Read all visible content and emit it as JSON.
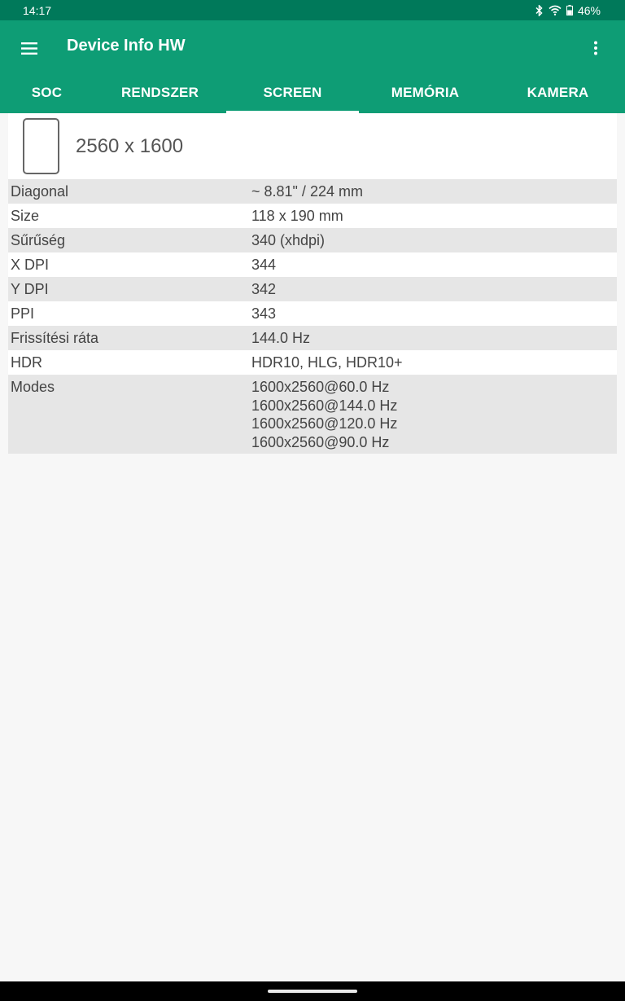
{
  "status_bar": {
    "time": "14:17",
    "battery": "46%",
    "icons": [
      "bluetooth-icon",
      "wifi-icon",
      "battery-icon"
    ]
  },
  "app_bar": {
    "title": "Device Info HW",
    "menu_icon": "hamburger-menu-icon",
    "overflow_icon": "more-vert-icon",
    "color": "#0e9d75"
  },
  "tabs": [
    {
      "label": "SOC",
      "active": false
    },
    {
      "label": "RENDSZER",
      "active": false
    },
    {
      "label": "SCREEN",
      "active": true
    },
    {
      "label": "MEMÓRIA",
      "active": false
    },
    {
      "label": "KAMERA",
      "active": false
    }
  ],
  "screen": {
    "resolution": "2560 x 1600",
    "device_icon": "tablet-icon",
    "rows": [
      {
        "label": "Diagonal",
        "value": "~ 8.81\" / 224 mm"
      },
      {
        "label": "Size",
        "value": "118 x 190 mm"
      },
      {
        "label": "Sűrűség",
        "value": "340 (xhdpi)"
      },
      {
        "label": "X DPI",
        "value": "344"
      },
      {
        "label": "Y DPI",
        "value": "342"
      },
      {
        "label": "PPI",
        "value": "343"
      },
      {
        "label": "Frissítési ráta",
        "value": "144.0 Hz"
      },
      {
        "label": "HDR",
        "value": "HDR10, HLG, HDR10+"
      }
    ],
    "modes": {
      "label": "Modes",
      "values": [
        "1600x2560@60.0 Hz",
        "1600x2560@144.0 Hz",
        "1600x2560@120.0 Hz",
        "1600x2560@90.0 Hz"
      ]
    }
  }
}
